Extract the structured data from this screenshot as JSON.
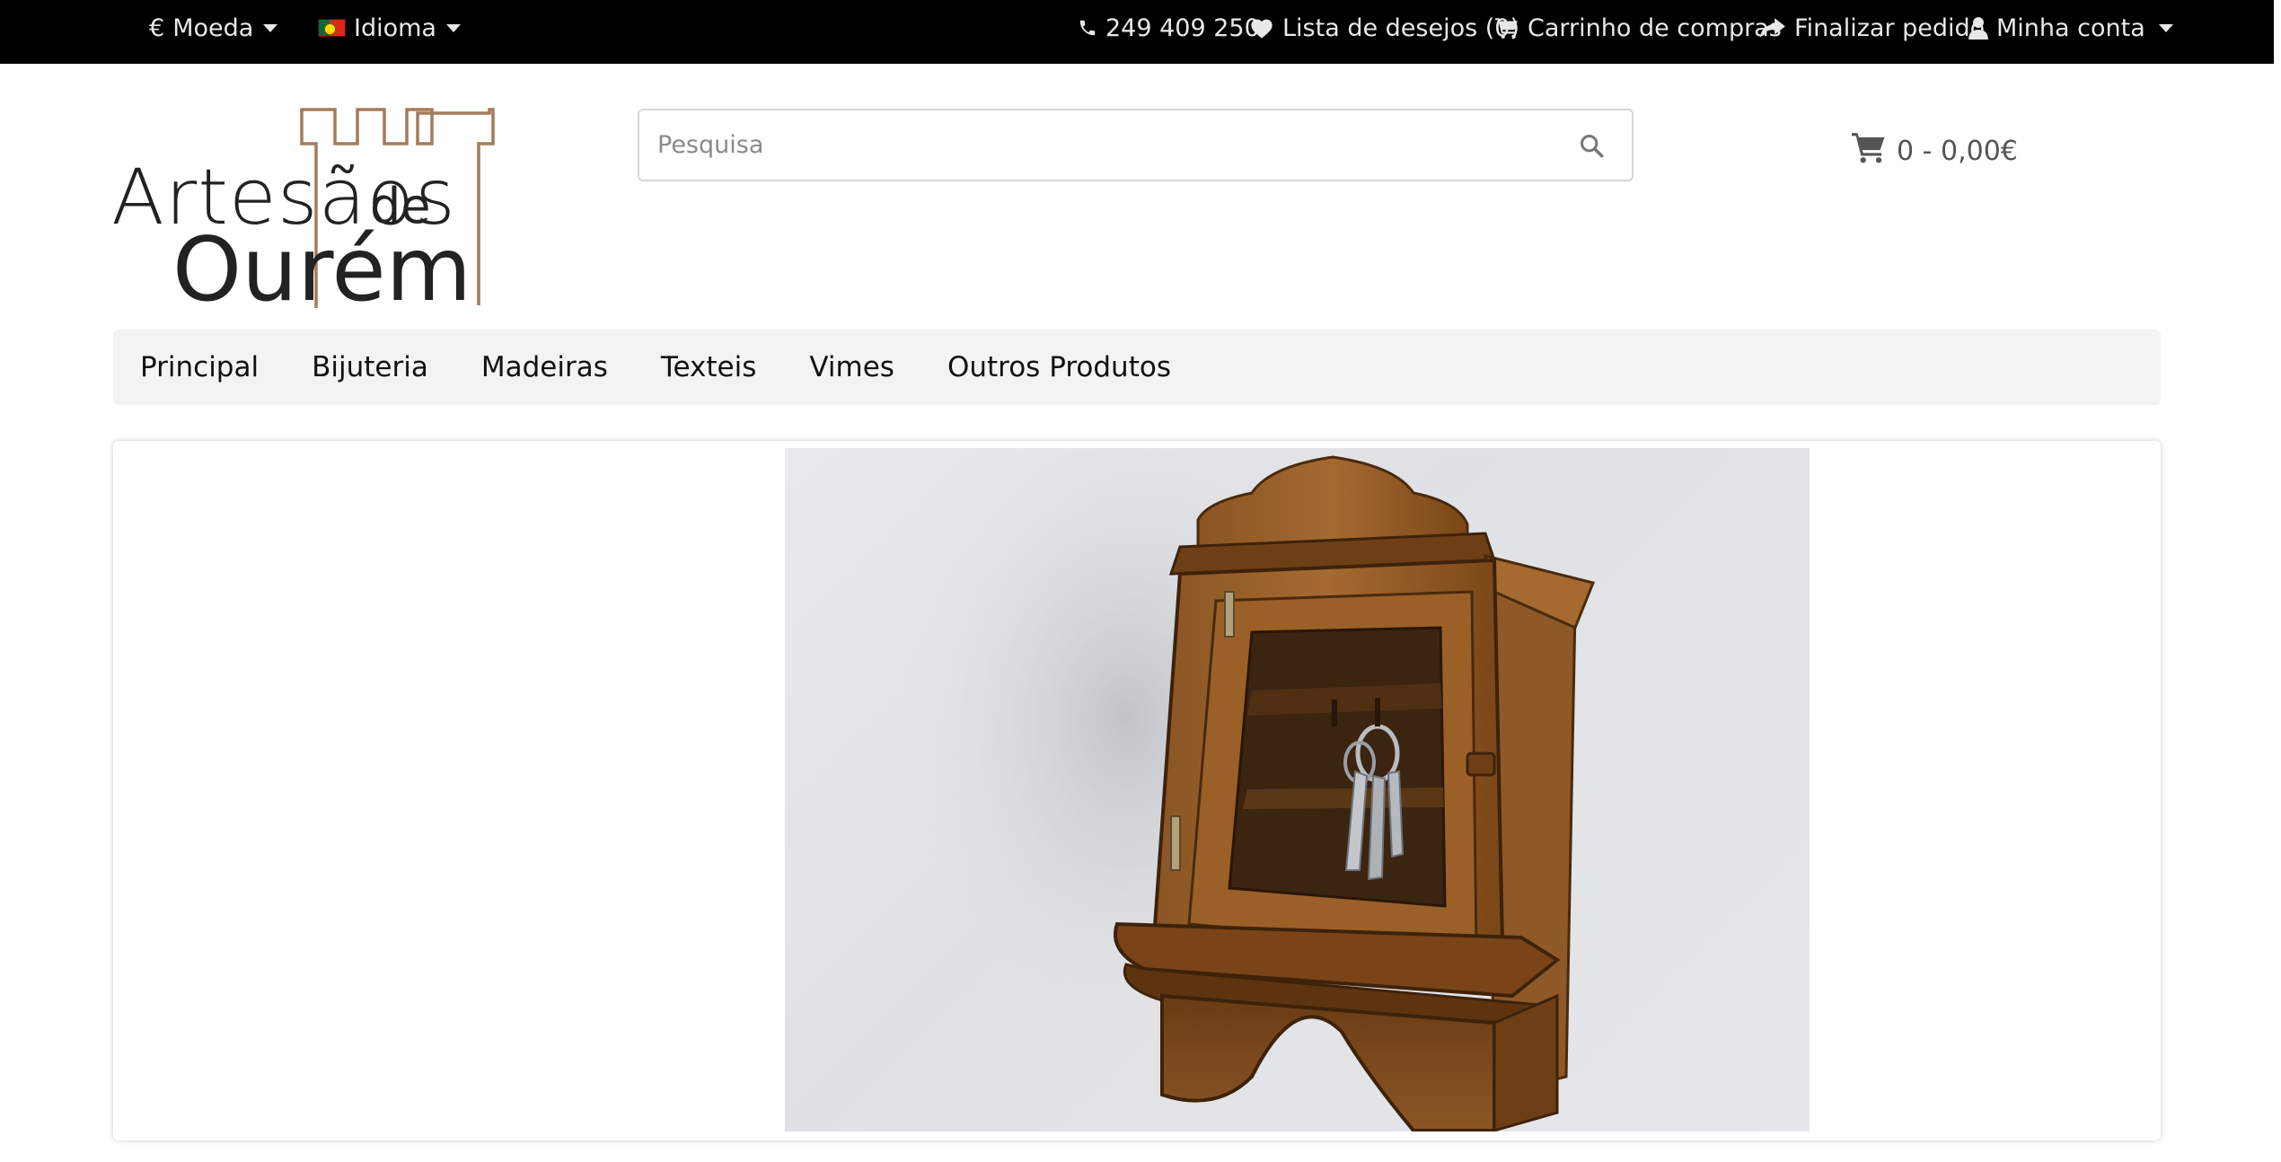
{
  "topbar": {
    "currency": {
      "symbol": "€",
      "label": "Moeda"
    },
    "language": {
      "label": "Idioma"
    },
    "phone": "249 409 250",
    "wishlist": "Lista de desejos (0)",
    "cart": "Carrinho de compras",
    "checkout": "Finalizar pedido",
    "account": "Minha conta"
  },
  "logo": {
    "line1": "Artesãos",
    "line2": "de",
    "line3": "Ourém"
  },
  "search": {
    "placeholder": "Pesquisa"
  },
  "cart_summary": {
    "text": "0 - 0,00€"
  },
  "nav": {
    "items": [
      {
        "label": "Principal"
      },
      {
        "label": "Bijuteria"
      },
      {
        "label": "Madeiras"
      },
      {
        "label": "Texteis"
      },
      {
        "label": "Vimes"
      },
      {
        "label": "Outros Produtos"
      }
    ]
  },
  "colors": {
    "topbar_bg": "#000000",
    "nav_bg": "#f3f3f3",
    "logo_accent": "#a47b5a",
    "wood": "#7a4a1c"
  },
  "icons": [
    "phone-icon",
    "heart-icon",
    "cart-icon",
    "share-icon",
    "user-icon",
    "search-icon",
    "flag-pt-icon"
  ]
}
